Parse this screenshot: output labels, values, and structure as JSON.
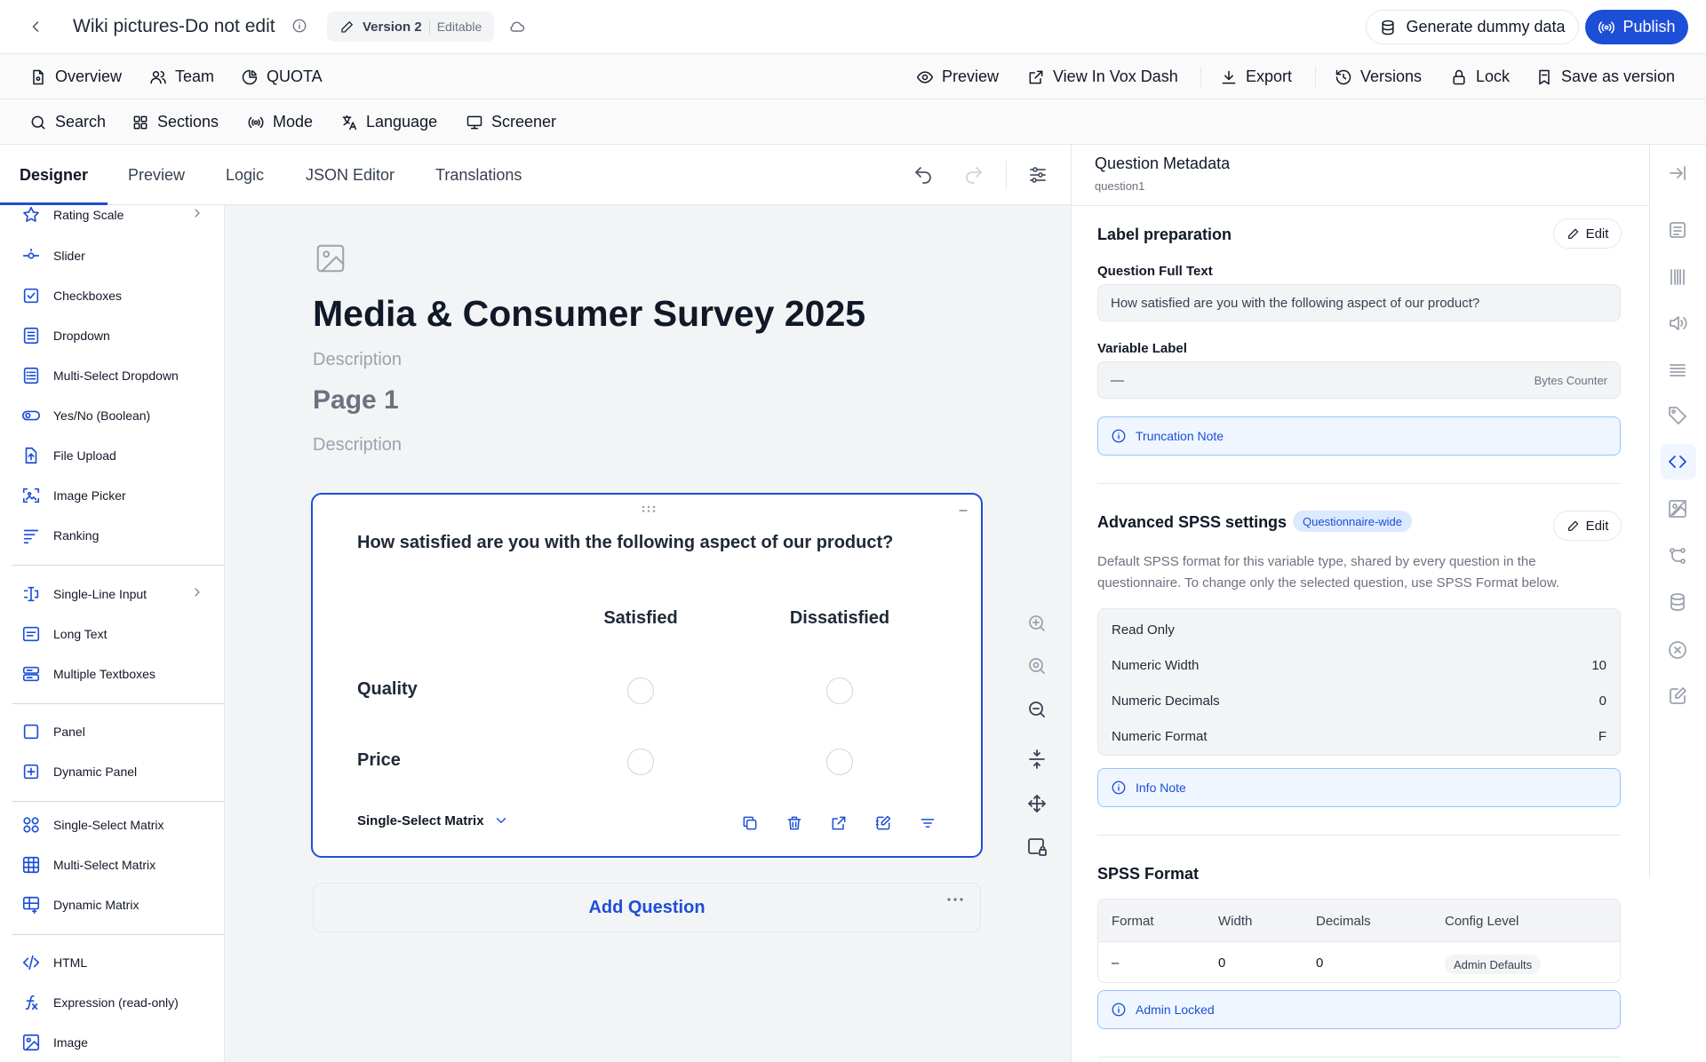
{
  "header": {
    "title": "Wiki pictures-Do not edit",
    "version_name": "Version 2",
    "version_state": "Editable",
    "generate_label": "Generate dummy data",
    "publish_label": "Publish"
  },
  "nav": {
    "overview": "Overview",
    "team": "Team",
    "quota": "QUOTA",
    "preview": "Preview",
    "view_vox": "View In Vox Dash",
    "export": "Export",
    "versions": "Versions",
    "lock": "Lock",
    "save_version": "Save as version"
  },
  "toolbar": {
    "search": "Search",
    "sections": "Sections",
    "mode": "Mode",
    "language": "Language",
    "screener": "Screener"
  },
  "tabs": {
    "designer": "Designer",
    "preview": "Preview",
    "logic": "Logic",
    "json": "JSON Editor",
    "translations": "Translations"
  },
  "sidebar": {
    "items": [
      "Rating Scale",
      "Slider",
      "Checkboxes",
      "Dropdown",
      "Multi-Select Dropdown",
      "Yes/No (Boolean)",
      "File Upload",
      "Image Picker",
      "Ranking",
      "Single-Line Input",
      "Long Text",
      "Multiple Textboxes",
      "Panel",
      "Dynamic Panel",
      "Single-Select Matrix",
      "Multi-Select Matrix",
      "Dynamic Matrix",
      "HTML",
      "Expression (read-only)",
      "Image"
    ]
  },
  "survey": {
    "title": "Media & Consumer Survey 2025",
    "description_placeholder": "Description",
    "page_title": "Page 1",
    "page_description_placeholder": "Description",
    "question": {
      "text": "How satisfied are you with the following aspect of our product?",
      "columns": [
        "Satisfied",
        "Dissatisfied"
      ],
      "rows": [
        "Quality",
        "Price"
      ],
      "type": "Single-Select Matrix"
    },
    "add_question": "Add Question"
  },
  "metadata": {
    "title": "Question Metadata",
    "question_id": "question1",
    "label_prep": {
      "title": "Label preparation",
      "edit": "Edit",
      "full_text_label": "Question Full Text",
      "full_text_value": "How satisfied are you with the following aspect of our product?",
      "var_label": "Variable Label",
      "var_value": "—",
      "bytes_hint": "Bytes Counter",
      "truncation_note": "Truncation Note"
    },
    "advanced": {
      "title": "Advanced SPSS settings",
      "badge": "Questionnaire-wide",
      "edit": "Edit",
      "description": "Default SPSS format for this variable type, shared by every question in the questionnaire. To change only the selected question, use SPSS Format below.",
      "read_only": "Read Only",
      "rows": [
        {
          "label": "Numeric Width",
          "value": "10"
        },
        {
          "label": "Numeric Decimals",
          "value": "0"
        },
        {
          "label": "Numeric Format",
          "value": "F"
        }
      ],
      "info_note": "Info Note"
    },
    "spss_format": {
      "title": "SPSS Format",
      "headers": [
        "Format",
        "Width",
        "Decimals",
        "Config Level"
      ],
      "row": {
        "format": "–",
        "width": "0",
        "decimals": "0",
        "level": "Admin Defaults"
      },
      "admin_note": "Admin Locked"
    }
  }
}
